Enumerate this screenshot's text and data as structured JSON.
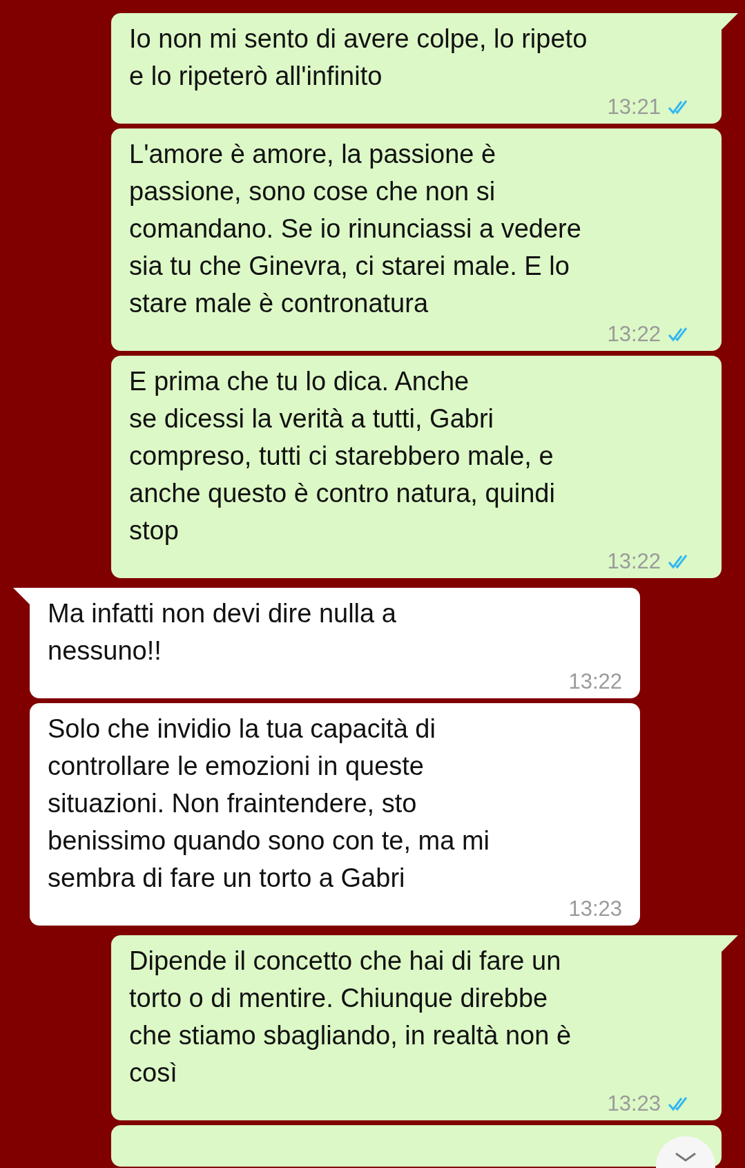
{
  "messages": [
    {
      "outgoing": true,
      "tail": true,
      "lines": [
        "Io non mi sento di avere colpe, lo ripeto",
        "e lo ripeterò all'infinito"
      ],
      "time": "13:21",
      "read": true
    },
    {
      "outgoing": true,
      "tail": false,
      "lines": [
        "L'amore è amore, la passione è",
        "passione, sono cose che non si",
        "comandano. Se io rinunciassi a vedere",
        "sia tu che Ginevra, ci starei male. E lo",
        "stare male è contronatura"
      ],
      "time": "13:22",
      "read": true
    },
    {
      "outgoing": true,
      "tail": false,
      "lines": [
        "E prima che tu lo dica. Anche",
        "se dicessi la verità a tutti, Gabri",
        "compreso, tutti ci starebbero male, e",
        "anche questo è contro natura, quindi",
        "stop"
      ],
      "time": "13:22",
      "read": true
    },
    {
      "outgoing": false,
      "tail": true,
      "lines": [
        "Ma infatti non devi dire nulla a",
        "nessuno!!"
      ],
      "time": "13:22"
    },
    {
      "outgoing": false,
      "tail": false,
      "lines": [
        "Solo che invidio la tua capacità di",
        "controllare le emozioni in queste",
        "situazioni. Non fraintendere, sto",
        "benissimo quando sono con te, ma mi",
        "sembra di fare un torto a Gabri"
      ],
      "time": "13:23"
    },
    {
      "outgoing": true,
      "tail": true,
      "lines": [
        "Dipende il concetto che hai di fare un",
        "torto o di mentire. Chiunque direbbe",
        "che stiamo sbagliando, in realtà non è",
        "così"
      ],
      "time": "13:23",
      "read": true
    }
  ]
}
